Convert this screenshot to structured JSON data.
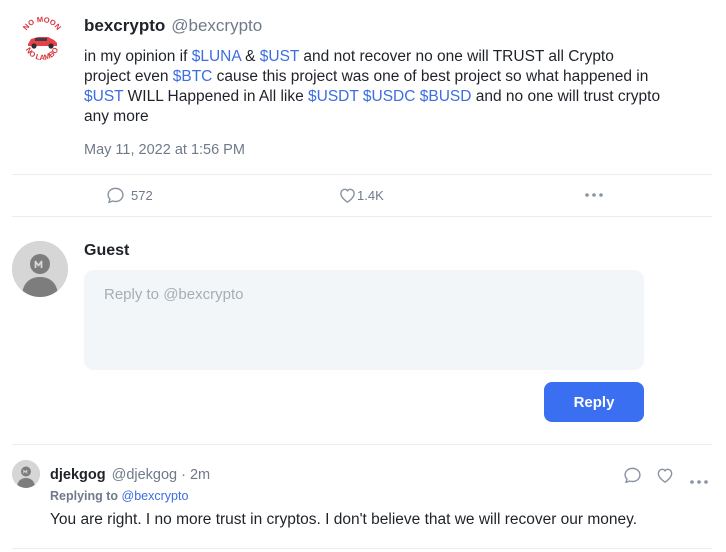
{
  "post": {
    "author_name": "bexcrypto",
    "author_handle": "@bexcrypto",
    "avatar_text_top": "NO MOON",
    "avatar_text_bottom": "NO LAMBO",
    "body": {
      "t1": "in my opinion if ",
      "tag1": "$LUNA",
      "t2": " & ",
      "tag2": "$UST",
      "t3": " and not recover no one will TRUST all Crypto project even ",
      "tag3": "$BTC",
      "t4": " cause this project was one of best project so what happened in ",
      "tag4": "$UST",
      "t5": " WILL Happened in All like ",
      "tag5": "$USDT",
      "t6": " ",
      "tag6": "$USDC",
      "t7": " ",
      "tag7": "$BUSD",
      "t8": " and no one will trust crypto any more"
    },
    "date": "May 11, 2022 at 1:56 PM",
    "comments_count": "572",
    "likes_count": "1.4K"
  },
  "reply_form": {
    "user_name": "Guest",
    "placeholder": "Reply to @bexcrypto",
    "button_label": "Reply"
  },
  "comments": [
    {
      "name": "djekgog",
      "handle": "@djekgog",
      "time": " · 2m",
      "replying_label": "Replying to ",
      "replying_to": "@bexcrypto",
      "text": "You are right. I no more trust in cryptos. I don't believe that we will recover our money."
    }
  ],
  "colors": {
    "accent": "#3a6ff2",
    "tag": "#3b6ee0",
    "muted": "#707a8a",
    "input_bg": "#f3f6f9",
    "avatar_car": "#e8414a"
  },
  "icons": [
    "comment-icon",
    "heart-icon",
    "more-icon",
    "guest-avatar-icon",
    "user-avatar-icon"
  ]
}
